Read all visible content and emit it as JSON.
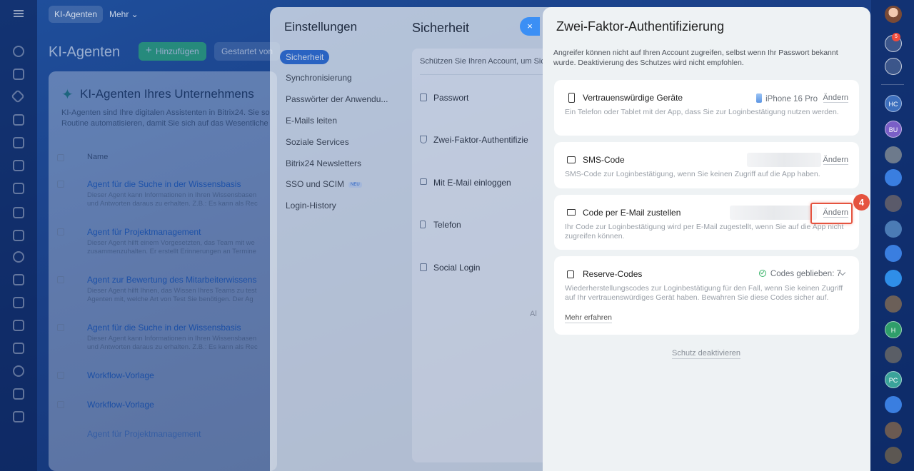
{
  "topbar": {
    "tab_active": "KI-Agenten",
    "tab_more": "Mehr ⌄"
  },
  "background_page": {
    "title": "KI-Agenten",
    "add_button": "Hinzufügen",
    "started_button": "Gestartet von",
    "card_title": "KI-Agenten Ihres Unternehmens",
    "intro_line1": "KI-Agenten sind Ihre digitalen Assistenten in Bitrix24. Sie so",
    "intro_line2": "Routine automatisieren, damit Sie sich auf das Wesentliche",
    "column_name": "Name",
    "agents": [
      {
        "name": "Agent für die Suche in der Wissensbasis",
        "desc1": "Dieser Agent kann Informationen in Ihren Wissensbasen",
        "desc2": "und Antworten daraus zu erhalten. Z.B.: Es kann als Rec"
      },
      {
        "name": "Agent für Projektmanagement",
        "desc1": "Dieser Agent hilft einem Vorgesetzten, das Team mit we",
        "desc2": "zusammenzuhalten. Er erstellt Erinnerungen an Termine"
      },
      {
        "name": "Agent zur Bewertung des Mitarbeiterwissens",
        "desc1": "Dieser Agent hilft Ihnen, das Wissen Ihres Teams zu test",
        "desc2": "Agenten mit, welche Art von Test Sie benötigen. Der Ag"
      },
      {
        "name": "Agent für die Suche in der Wissensbasis",
        "desc1": "Dieser Agent kann Informationen in Ihren Wissensbasen",
        "desc2": "und Antworten daraus zu erhalten. Z.B.: Es kann als Rec"
      },
      {
        "name": "Workflow-Vorlage",
        "desc1": "",
        "desc2": ""
      },
      {
        "name": "Workflow-Vorlage",
        "desc1": "",
        "desc2": ""
      },
      {
        "name": "Agent für Projektmanagement",
        "desc1": "",
        "desc2": ""
      }
    ]
  },
  "settings": {
    "title": "Einstellungen",
    "section_title": "Sicherheit",
    "nav": [
      "Sicherheit",
      "Synchronisierung",
      "Passwörter der Anwendu...",
      "E-Mails leiten",
      "Soziale Services",
      "Bitrix24 Newsletters",
      "SSO und SCIM",
      "Login-History"
    ],
    "nav_new_badge": "NEU",
    "content_intro": "Schützen Sie Ihren Account, um Sic",
    "items": [
      "Passwort",
      "Zwei-Faktor-Authentifizie",
      "Mit E-Mail einloggen",
      "Telefon",
      "Social Login"
    ],
    "faded_text": "Al"
  },
  "close_label": "×",
  "tfa": {
    "title": "Zwei-Faktor-Authentifizierung",
    "intro": "Angreifer können nicht auf Ihren Account zugreifen, selbst wenn Ihr Passwort bekannt wurde. Deaktivierung des Schutzes wird nicht empfohlen.",
    "cards": {
      "devices": {
        "title": "Vertrauenswürdige Geräte",
        "device": "iPhone 16 Pro",
        "change": "Ändern",
        "desc": "Ein Telefon oder Tablet mit der App, dass Sie zur Loginbestätigung nutzen werden."
      },
      "sms": {
        "title": "SMS-Code",
        "change": "Ändern",
        "desc": "SMS-Code zur Loginbestätigung, wenn Sie keinen Zugriff auf die App haben."
      },
      "email": {
        "title": "Code per E-Mail zustellen",
        "change": "Ändern",
        "desc": "Ihr Code zur Loginbestätigung wird per E-Mail zugestellt, wenn Sie auf die App nicht zugreifen können."
      },
      "backup": {
        "title": "Reserve-Codes",
        "codes_left": "Codes geblieben: 7",
        "desc": "Wiederherstellungscodes zur Loginbestätigung für den Fall, wenn Sie keinen Zugriff auf Ihr vertrauenswürdiges Gerät haben. Bewahren Sie diese Codes sicher auf.",
        "learn_more": "Mehr erfahren"
      }
    },
    "disable_link": "Schutz deaktivieren"
  },
  "annotation": {
    "step_number": "4",
    "color": "#e5533f"
  },
  "right_rail": {
    "notification_count": "5",
    "avatars": [
      "HC",
      "BU",
      "H",
      "PC"
    ]
  }
}
